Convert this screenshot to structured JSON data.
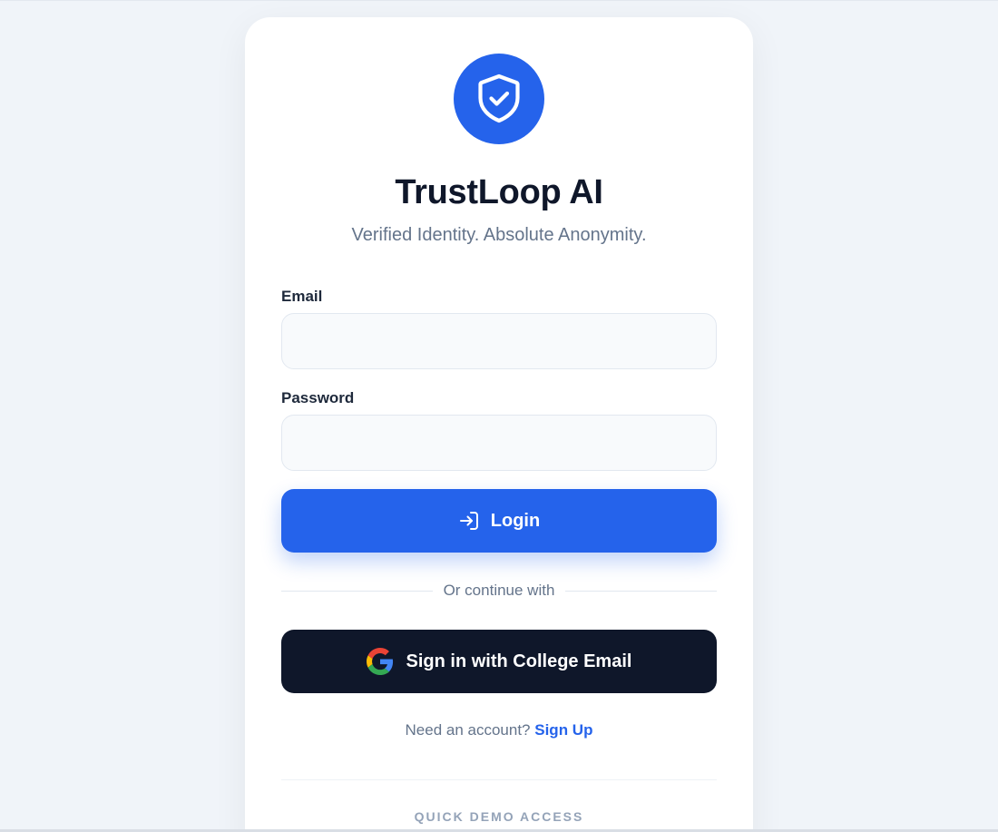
{
  "app": {
    "title": "TrustLoop AI",
    "tagline": "Verified Identity. Absolute Anonymity."
  },
  "form": {
    "email": {
      "label": "Email",
      "value": "",
      "placeholder": ""
    },
    "password": {
      "label": "Password",
      "value": "",
      "placeholder": ""
    },
    "login_label": "Login",
    "divider_text": "Or continue with",
    "google_label": "Sign in with College Email"
  },
  "signup": {
    "prompt": "Need an account?",
    "link_label": "Sign Up"
  },
  "demo": {
    "heading": "QUICK DEMO ACCESS"
  },
  "icons": {
    "logo": "shield-check-icon",
    "login": "login-arrow-icon",
    "google": "google-icon"
  },
  "colors": {
    "primary": "#2563eb",
    "dark_button": "#0f172a",
    "background": "#f0f4f9",
    "title": "#0f172a",
    "muted": "#64748b"
  }
}
